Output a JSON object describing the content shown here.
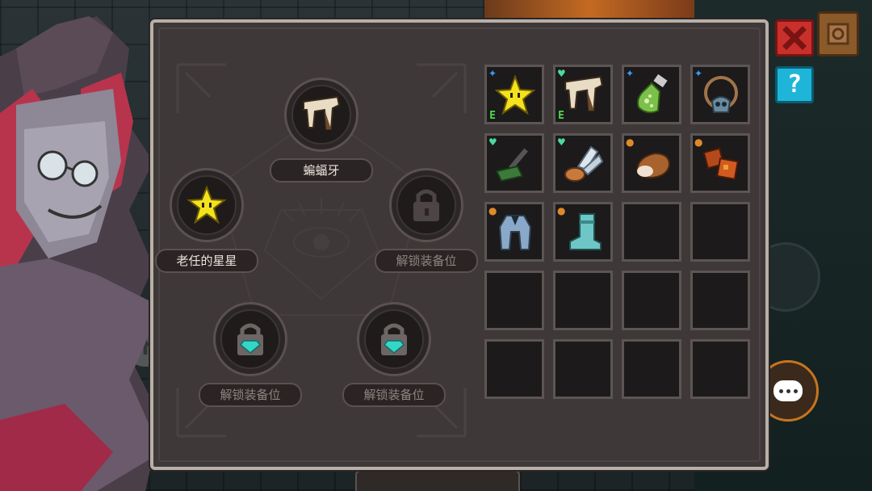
{
  "equip_slots": {
    "top": {
      "label": "蝙蝠牙",
      "icon": "bat-fang-icon"
    },
    "left": {
      "label": "老任的星星",
      "icon": "star-icon"
    },
    "right": {
      "label": "解锁装备位",
      "icon": "lock-icon"
    },
    "bottom_left": {
      "label": "解锁装备位",
      "icon": "gem-lock-icon"
    },
    "bottom_right": {
      "label": "解锁装备位",
      "icon": "gem-lock-icon"
    }
  },
  "inventory": {
    "equipped_marker": "E",
    "items": [
      {
        "name": "star",
        "badge": "✦",
        "badge_color": "blue",
        "equipped": true
      },
      {
        "name": "bat-fang",
        "badge": "♥",
        "badge_color": "green",
        "equipped": true
      },
      {
        "name": "potion-bottle",
        "badge": "✦",
        "badge_color": "blue",
        "equipped": false
      },
      {
        "name": "skull-necklace",
        "badge": "✦",
        "badge_color": "blue",
        "equipped": false
      },
      {
        "name": "green-hammer",
        "badge": "♥",
        "badge_color": "green",
        "equipped": false
      },
      {
        "name": "wings-scroll",
        "badge": "♥",
        "badge_color": "green",
        "equipped": false
      },
      {
        "name": "bread",
        "badge": "●",
        "badge_color": "orange",
        "equipped": false
      },
      {
        "name": "meat-chunks",
        "badge": "●",
        "badge_color": "orange",
        "equipped": false
      },
      {
        "name": "iron-armor",
        "badge": "●",
        "badge_color": "orange",
        "equipped": false
      },
      {
        "name": "boots",
        "badge": "●",
        "badge_color": "orange",
        "equipped": false
      }
    ],
    "total_cells": 20
  },
  "buttons": {
    "help_label": "?"
  },
  "colors": {
    "panel_bg": "#3e3838",
    "panel_border": "#b8b0a8",
    "close_red": "#c9302c",
    "help_cyan": "#1fb5d8",
    "chat_orange": "#c8741f"
  }
}
